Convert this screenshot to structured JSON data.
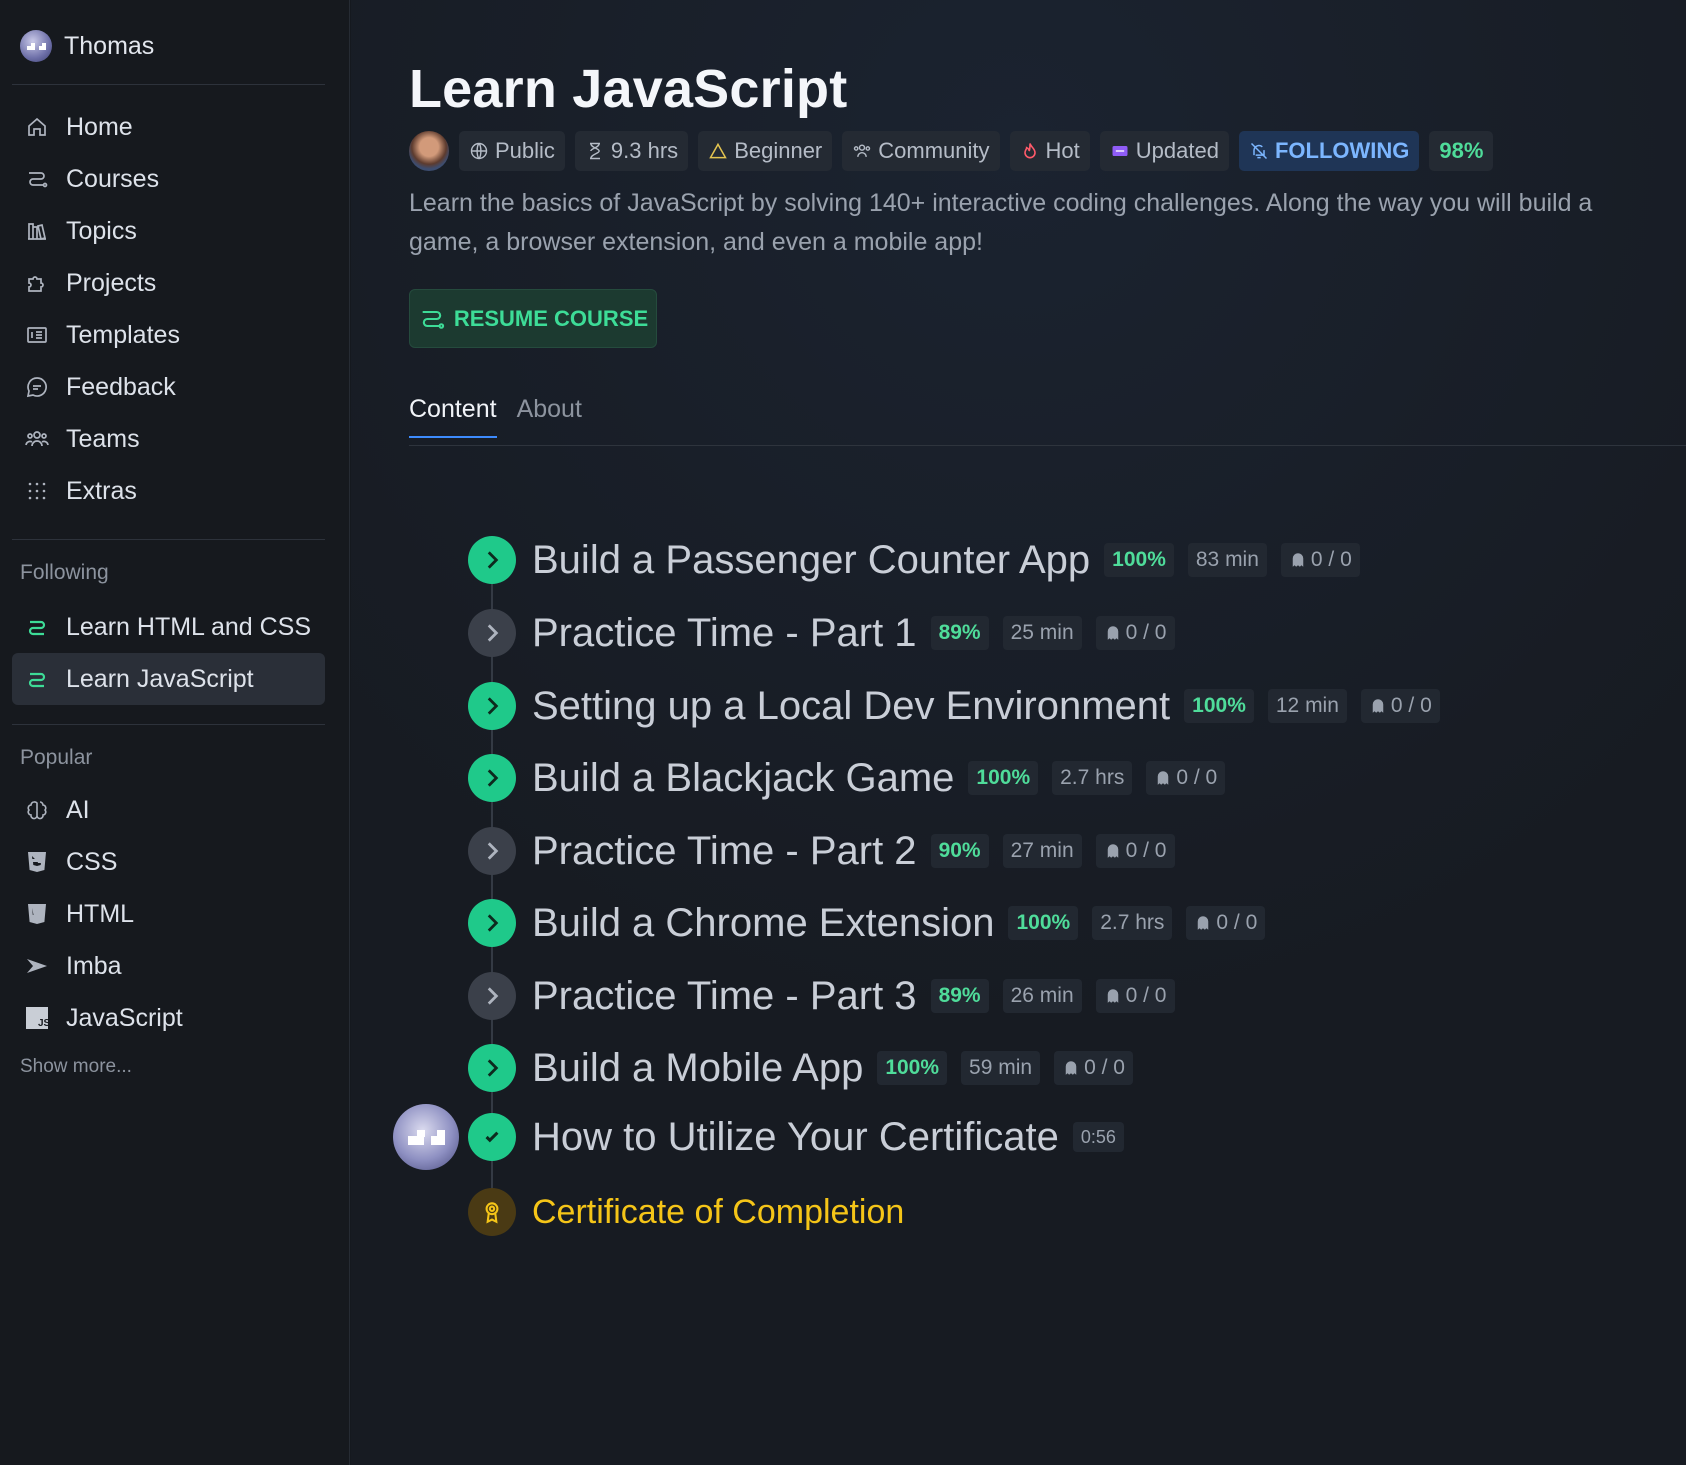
{
  "user": {
    "name": "Thomas"
  },
  "nav": [
    {
      "label": "Home",
      "icon": "home-icon"
    },
    {
      "label": "Courses",
      "icon": "route-icon"
    },
    {
      "label": "Topics",
      "icon": "books-icon"
    },
    {
      "label": "Projects",
      "icon": "puzzle-icon"
    },
    {
      "label": "Templates",
      "icon": "template-icon"
    },
    {
      "label": "Feedback",
      "icon": "chat-icon"
    },
    {
      "label": "Teams",
      "icon": "users-icon"
    },
    {
      "label": "Extras",
      "icon": "grid-dots-icon"
    }
  ],
  "following": {
    "label": "Following",
    "items": [
      {
        "label": "Learn HTML and CSS",
        "icon": "course-path-icon"
      },
      {
        "label": "Learn JavaScript",
        "icon": "course-path-icon",
        "active": true
      }
    ]
  },
  "popular": {
    "label": "Popular",
    "items": [
      {
        "label": "AI",
        "icon": "brain-icon"
      },
      {
        "label": "CSS",
        "icon": "css3-icon"
      },
      {
        "label": "HTML",
        "icon": "html5-icon"
      },
      {
        "label": "Imba",
        "icon": "imba-icon"
      },
      {
        "label": "JavaScript",
        "icon": "js-icon"
      }
    ],
    "show_more": "Show more..."
  },
  "course": {
    "title": "Learn JavaScript",
    "chips": {
      "visibility": "Public",
      "duration": "9.3 hrs",
      "level": "Beginner",
      "type": "Community",
      "hot": "Hot",
      "updated": "Updated",
      "following": "FOLLOWING",
      "progress": "98%"
    },
    "description": "Learn the basics of JavaScript by solving 140+ interactive coding challenges. Along the way you will build a game, a browser extension, and even a mobile app!",
    "resume_label": "RESUME COURSE"
  },
  "tabs": [
    {
      "label": "Content",
      "active": true
    },
    {
      "label": "About",
      "active": false
    }
  ],
  "lessons": [
    {
      "title": "Build a Passenger Counter App",
      "pct": "100%",
      "duration": "83 min",
      "challenges": "0 / 0",
      "status": "done"
    },
    {
      "title": "Practice Time - Part 1",
      "pct": "89%",
      "duration": "25 min",
      "challenges": "0 / 0",
      "status": "partial"
    },
    {
      "title": "Setting up a Local Dev Environment",
      "pct": "100%",
      "duration": "12 min",
      "challenges": "0 / 0",
      "status": "done"
    },
    {
      "title": "Build a Blackjack Game",
      "pct": "100%",
      "duration": "2.7 hrs",
      "challenges": "0 / 0",
      "status": "done"
    },
    {
      "title": "Practice Time - Part 2",
      "pct": "90%",
      "duration": "27 min",
      "challenges": "0 / 0",
      "status": "partial"
    },
    {
      "title": "Build a Chrome Extension",
      "pct": "100%",
      "duration": "2.7 hrs",
      "challenges": "0 / 0",
      "status": "done"
    },
    {
      "title": "Practice Time - Part 3",
      "pct": "89%",
      "duration": "26 min",
      "challenges": "0 / 0",
      "status": "partial"
    },
    {
      "title": "Build a Mobile App",
      "pct": "100%",
      "duration": "59 min",
      "challenges": "0 / 0",
      "status": "done"
    },
    {
      "title": "How to Utilize Your Certificate",
      "duration": "0:56",
      "status": "checked"
    },
    {
      "title": "Certificate of Completion",
      "status": "certificate"
    }
  ],
  "colors": {
    "accent_green": "#1fc98a",
    "following_blue": "#7cb6ff",
    "certificate_gold": "#f5c518",
    "background": "#15191f"
  }
}
